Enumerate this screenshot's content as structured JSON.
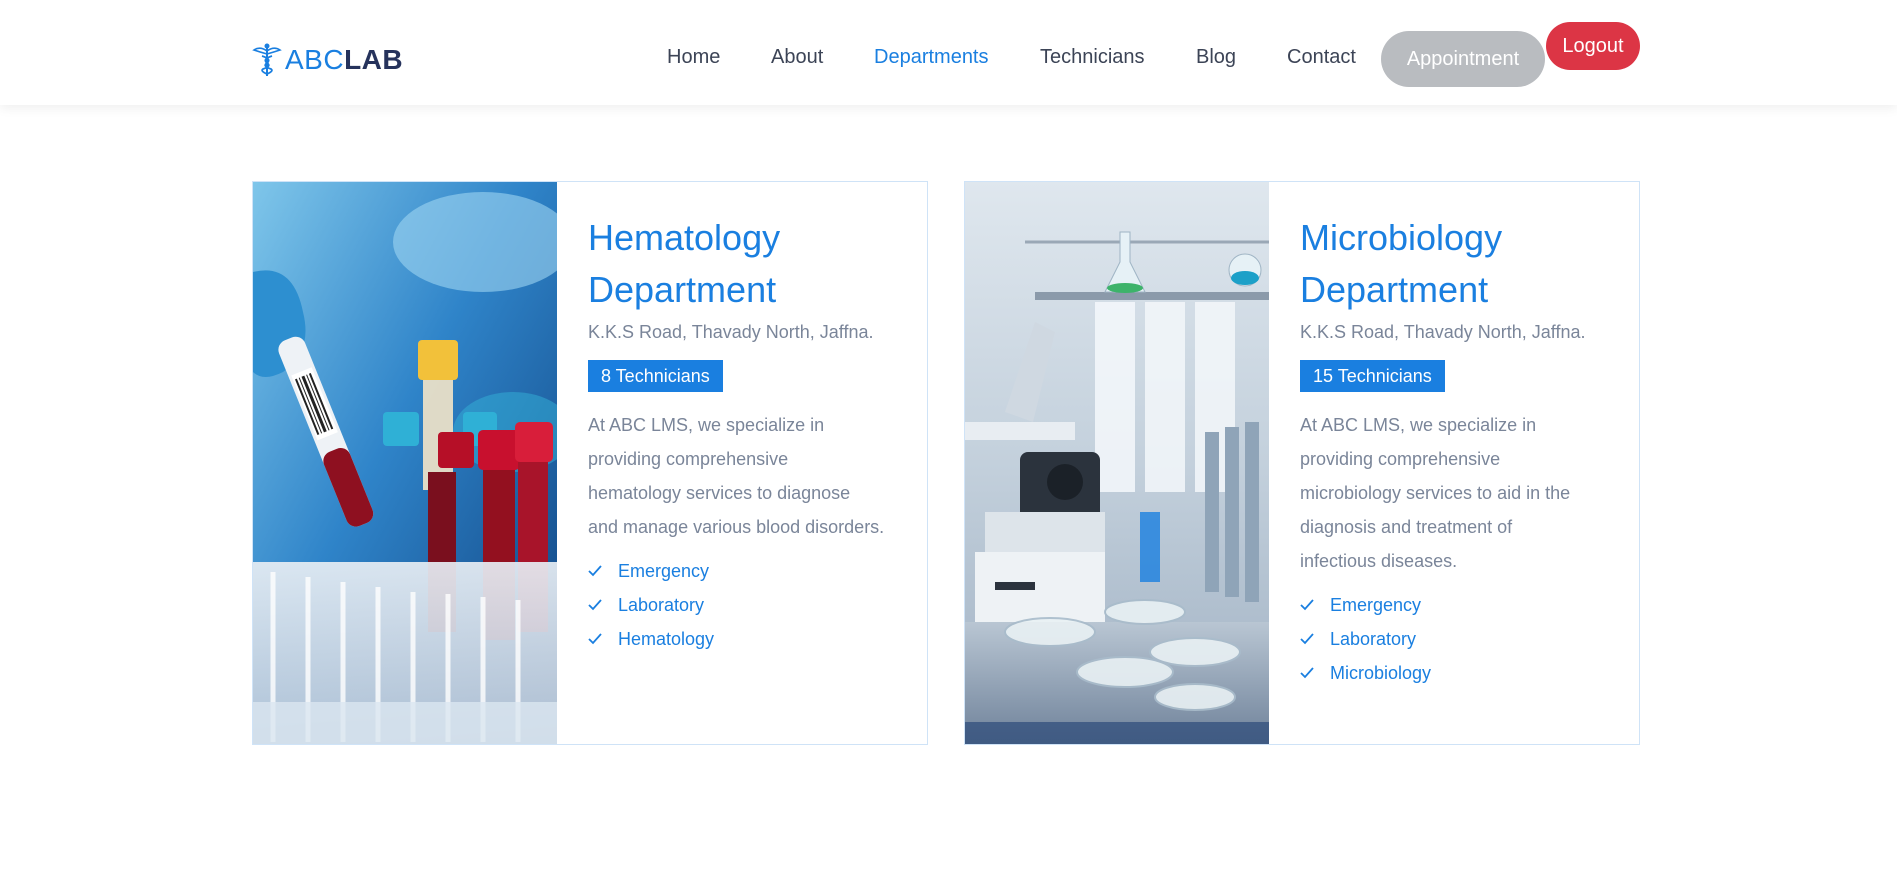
{
  "brand": {
    "light": "ABC",
    "bold": "LAB",
    "icon": "caduceus-icon"
  },
  "nav": {
    "items": [
      {
        "label": "Home",
        "active": false
      },
      {
        "label": "About",
        "active": false
      },
      {
        "label": "Departments",
        "active": true
      },
      {
        "label": "Technicians",
        "active": false
      },
      {
        "label": "Blog",
        "active": false
      },
      {
        "label": "Contact",
        "active": false
      }
    ],
    "appointment_label": "Appointment",
    "logout_label": "Logout"
  },
  "departments": [
    {
      "title_line1": "Hematology",
      "title_line2": "Department",
      "address": "K.K.S Road, Thavady North, Jaffna.",
      "technicians": "8 Technicians",
      "description_lines": [
        "At ABC LMS, we specialize in",
        "providing comprehensive",
        "hematology services to diagnose",
        "and manage various blood disorders."
      ],
      "features": [
        "Emergency",
        "Laboratory",
        "Hematology"
      ],
      "image": "blood-sample-tubes-photo"
    },
    {
      "title_line1": "Microbiology",
      "title_line2": "Department",
      "address": "K.K.S Road, Thavady North, Jaffna.",
      "technicians": "15 Technicians",
      "description_lines": [
        "At ABC LMS, we specialize in",
        "providing comprehensive",
        "microbiology services to aid in the",
        "diagnosis and treatment of",
        "infectious diseases."
      ],
      "features": [
        "Emergency",
        "Laboratory",
        "Microbiology"
      ],
      "image": "laboratory-microscope-photo"
    }
  ],
  "colors": {
    "primary": "#1a7fe0",
    "brand_dark": "#26335c",
    "appointment_bg": "#b9bcc0",
    "logout_bg": "#dc3545",
    "muted_text": "#7a8599"
  }
}
